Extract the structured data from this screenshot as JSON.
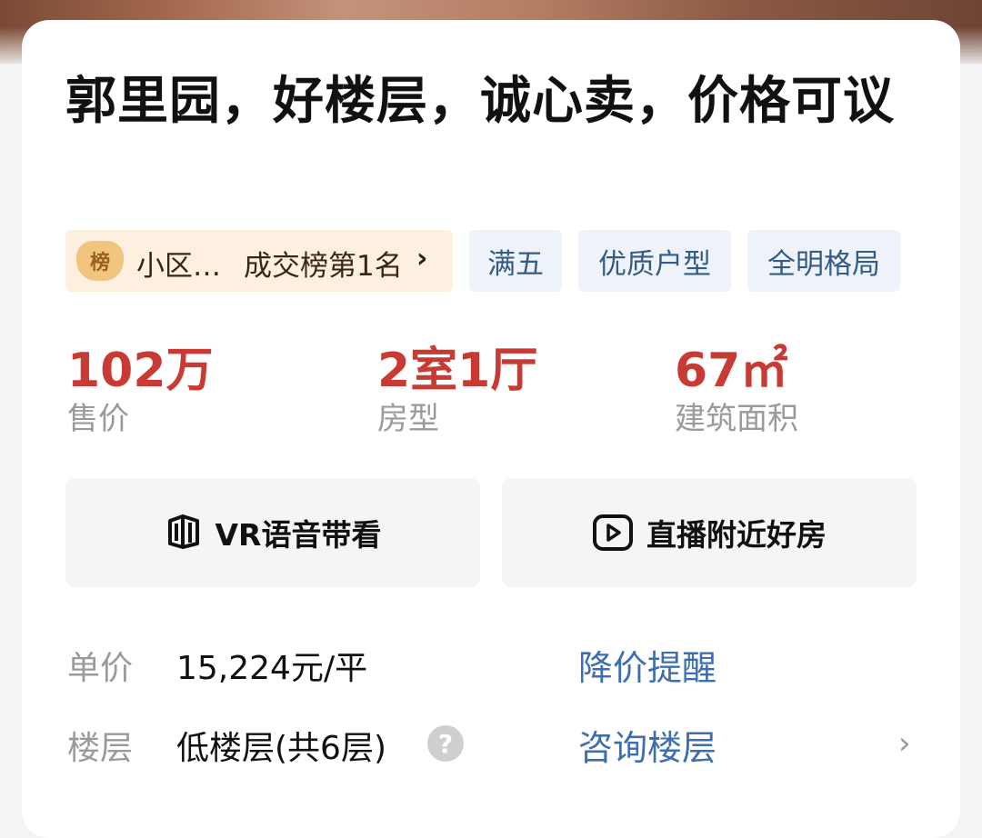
{
  "listing": {
    "title": "郭里园，好楼层，诚心卖，价格可议"
  },
  "tags": {
    "rank_badge": "榜",
    "rank_prefix": "小区…",
    "rank_label": "成交榜第1名",
    "rank_chevron": "›",
    "items": [
      "满五",
      "优质户型",
      "全明格局"
    ]
  },
  "stats": [
    {
      "value": "102万",
      "label": "售价"
    },
    {
      "value": "2室1厅",
      "label": "房型"
    },
    {
      "value": "67㎡",
      "label": "建筑面积"
    }
  ],
  "actions": {
    "vr": {
      "label": "VR语音带看",
      "icon": "vr-cube-icon"
    },
    "live": {
      "label": "直播附近好房",
      "icon": "play-icon"
    }
  },
  "info": {
    "unit_price": {
      "label": "单价",
      "value": "15,224元/平",
      "link": "降价提醒"
    },
    "floor": {
      "label": "楼层",
      "value": "低楼层(共6层)",
      "link": "咨询楼层",
      "help": "?",
      "chevron": "›"
    }
  },
  "colors": {
    "accent_red": "#c83a34",
    "link_blue": "#3d6fb0",
    "tag_blue_bg": "#eef3fa",
    "rank_bg": "#fdf0e0"
  }
}
